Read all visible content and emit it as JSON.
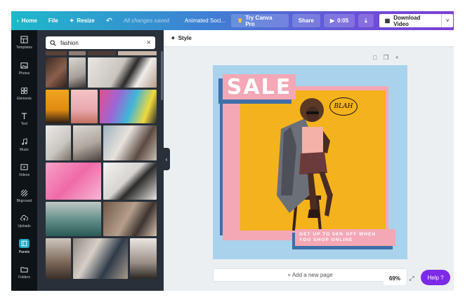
{
  "topbar": {
    "home": "Home",
    "file": "File",
    "resize": "Resize",
    "save_status": "All changes saved",
    "doc_title": "Animated Soci...",
    "try_pro": "Try Canva Pro",
    "share": "Share",
    "duration": "0:05",
    "download": "Download Video",
    "gradient": [
      "#1fb8c9",
      "#3f7fd4",
      "#7a3fd6"
    ]
  },
  "rail": {
    "items": [
      {
        "label": "Templates",
        "icon": "templates-icon"
      },
      {
        "label": "Photos",
        "icon": "photos-icon"
      },
      {
        "label": "Elements",
        "icon": "elements-icon"
      },
      {
        "label": "Text",
        "icon": "text-icon"
      },
      {
        "label": "Music",
        "icon": "music-icon"
      },
      {
        "label": "Videos",
        "icon": "videos-icon"
      },
      {
        "label": "Bkground",
        "icon": "background-icon"
      },
      {
        "label": "Uploads",
        "icon": "uploads-icon"
      },
      {
        "label": "Panels",
        "icon": "panels-icon"
      },
      {
        "label": "Folders",
        "icon": "folders-icon"
      }
    ],
    "active_index": 8
  },
  "panel": {
    "search_value": "fashion"
  },
  "toolbar": {
    "style_label": "Style"
  },
  "design": {
    "sale": "SALE",
    "promo_line1": "GET UP TO 50% OFF WHEN",
    "promo_line2": "YOU SHOP ONLINE",
    "bubble": "BLAH",
    "colors": {
      "background": "#a9d3ec",
      "accent": "#f4a7b5",
      "shadow": "#3f6fa9",
      "photo": "#f4b21c"
    }
  },
  "footer": {
    "add_page": "+ Add a new page",
    "zoom": "69%",
    "help": "Help ?"
  }
}
